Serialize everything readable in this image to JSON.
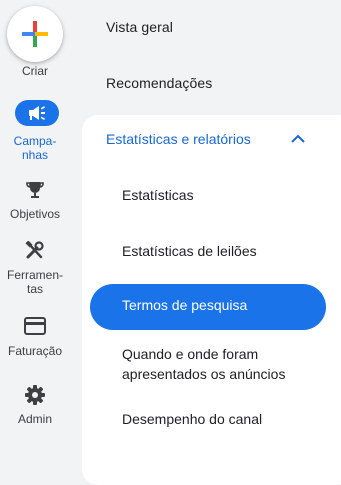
{
  "rail": {
    "create_label": "Criar",
    "items": [
      {
        "label_line1": "Campa-",
        "label_line2": "nhas",
        "icon": "campaign-icon",
        "active": true
      },
      {
        "label": "Objetivos",
        "icon": "trophy-icon"
      },
      {
        "label_line1": "Ferramen-",
        "label_line2": "tas",
        "icon": "tools-icon"
      },
      {
        "label": "Faturação",
        "icon": "credit-card-icon"
      },
      {
        "label": "Admin",
        "icon": "gear-icon"
      }
    ]
  },
  "panel": {
    "links": [
      "Vista geral",
      "Recomendações"
    ],
    "section": {
      "title": "Estatísticas e relatórios",
      "expanded": true,
      "items": [
        {
          "label": "Estatísticas"
        },
        {
          "label": "Estatísticas de leilões"
        },
        {
          "label": "Termos de pesquisa",
          "active": true
        },
        {
          "label_line1": "Quando e onde foram",
          "label_line2": "apresentados os anúncios"
        },
        {
          "label": "Desempenho do canal"
        }
      ]
    }
  },
  "colors": {
    "accent": "#1a73e8",
    "accent_text": "#1967d2",
    "background": "#f1f3f4"
  }
}
